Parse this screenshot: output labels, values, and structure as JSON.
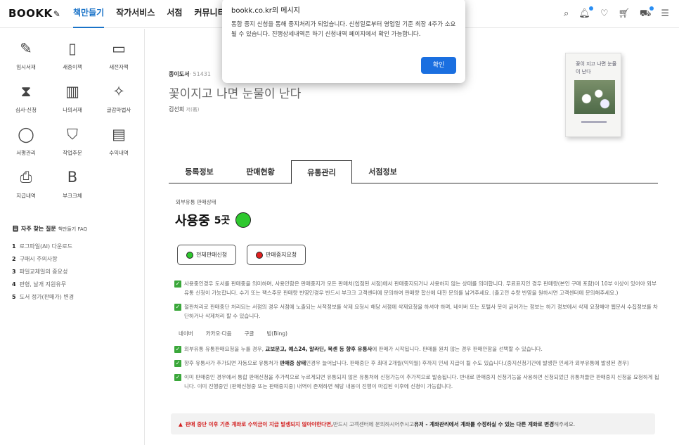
{
  "header": {
    "logo": "BOOKK",
    "nav": [
      "책만들기",
      "작가서비스",
      "서점",
      "커뮤니티"
    ],
    "icons": [
      "search-icon",
      "bell-icon",
      "heart-icon",
      "cart-icon",
      "truck-icon",
      "menu-icon"
    ]
  },
  "sidebar": {
    "items": [
      {
        "label": "임시서재",
        "icon": "pencil-icon"
      },
      {
        "label": "새종이책",
        "icon": "book-icon"
      },
      {
        "label": "새전자책",
        "icon": "tablet-icon"
      },
      {
        "label": "심사·신청",
        "icon": "hourglass-icon"
      },
      {
        "label": "나의서재",
        "icon": "bookshelf-icon"
      },
      {
        "label": "글감마법사",
        "icon": "magic-wand-icon"
      },
      {
        "label": "서평관리",
        "icon": "chat-icon"
      },
      {
        "label": "작업주문",
        "icon": "shopping-bag-icon"
      },
      {
        "label": "수익내역",
        "icon": "receipt-icon"
      },
      {
        "label": "지급내역",
        "icon": "printer-icon"
      },
      {
        "label": "부크크체",
        "icon": "font-b-icon"
      }
    ],
    "faq_title": "자주 찾는 질문",
    "faq_sub": "책만들기 FAQ",
    "faq": [
      {
        "num": "1",
        "text": "로그파일(AI) 다운로드"
      },
      {
        "num": "2",
        "text": "구매시 주의사항"
      },
      {
        "num": "3",
        "text": "파일교체일의 중요성"
      },
      {
        "num": "4",
        "text": "판형, 날개 지원유무"
      },
      {
        "num": "5",
        "text": "도서 정가(판매가) 변경"
      }
    ]
  },
  "book": {
    "type": "종이도서",
    "num": "· 51431",
    "title": "꽃이지고 나면 눈물이 난다",
    "author": "김선희",
    "role": "저(著)",
    "cover_text": "꽃이 지고 나면 눈물이 난다"
  },
  "tabs": [
    "등록정보",
    "판매현황",
    "유통관리",
    "서점정보"
  ],
  "distribution": {
    "label": "외부유통 판매상태",
    "status": "사용중",
    "count": "5곳",
    "btn_all": "전체판매신청",
    "btn_stop": "판매중지요청",
    "note1": "사용중인경우 도서를 판매중을 의미하며, 사용안함은 판매중지가 모든 판매처(입점된 서점)에서 판매중지되거나 사용하지 않는 상태를 의미합니다. 무료표지인 경우 판매량(본인 구매 포함)이 10부 이상이 있어야 외부유통 신청이 가능합니다. 수기 또는 팩스주문 판매량 반영인경우 반드시 부크크 고객센터에 문의하여 판매량 합산에 대한 문의를 남겨주세요. (출고전 수량 반영을 원하시면 고객센터에 문의해주세요.)",
    "note2": "절판처리로 판매중단 처리되는 서점의 경우 서점에 노출되는 서적정보를 삭제 요청시 해당 서점에 삭제요청을 하셔야 하며, 네이버 또는 포털사 봇이 긁어가는 정보는 하기 정보에서 삭제 요청해야 웹문서 수집정보를 차단하거나 삭제처리 할 수 있습니다.",
    "engines": [
      "네이버",
      "카카오·다음",
      "구글",
      "빙(Bing)"
    ],
    "note3_a": "외부유통 유통판매요청을 누를 경우, ",
    "note3_b": "교보문고, 예스24, 알라딘, 북센 등 향후 유통사",
    "note3_c": "에 판매가 시작됩니다. 판매를 원치 않는 경우 판매안함을 선택할 수 있습니다.",
    "note4_a": "향후 유통사가 추가되면 자동으로 유통처가 ",
    "note4_b": "판매중 상태",
    "note4_c": "인경우 늘어납니다. 판매중단 후 최대 2개월(익익월) 후까지 인세 지급이 될 수도 있습니다.(중지신청기간에 발생한 인세가 외부유통에 발생된 경우)",
    "note5": "이미 판매중인 경우에서 통합 판매신청을 추가적으로 누르게되면 유통되지 않은 유통처에 신청가능이 추가적으로 발송됩니다. 반내로 판매중지 신청기능을 사용하면 신청되었던 유통처들만 판매중지 신청을 요청하게 됩니다. 이미 진행중인 (판매신청중 또는 판매중지중) 내역이 존재하면 해당 내용이 진행이 마감된 이후에 신청이 가능합니다.",
    "alert_red": "판매 중단 이후 기존 계좌로 수익금이 지급 발생되지 않아야한다면,",
    "alert_mid": " 반드시 고객센터에 문의하시어주시고 ",
    "alert_bold": "유저 - 계좌관리에서 계좌를 수정하실 수 있는 다른 계좌로 변경",
    "alert_end": "해주세요."
  },
  "dialog": {
    "title": "bookk.co.kr의 메시지",
    "message": "통합 중지 신청을 통해 중지처리가 되었습니다. 신청일로부터 영업일 기준 최장 4주가 소요될 수 있습니다. 진행상세내역은 하기 신청내역 페이지에서 확인 가능합니다.",
    "ok": "확인"
  },
  "colors": {
    "accent": "#1a73c8",
    "green": "#2ec82e",
    "red": "#e02020",
    "dialog_button": "#1a6fe0"
  }
}
